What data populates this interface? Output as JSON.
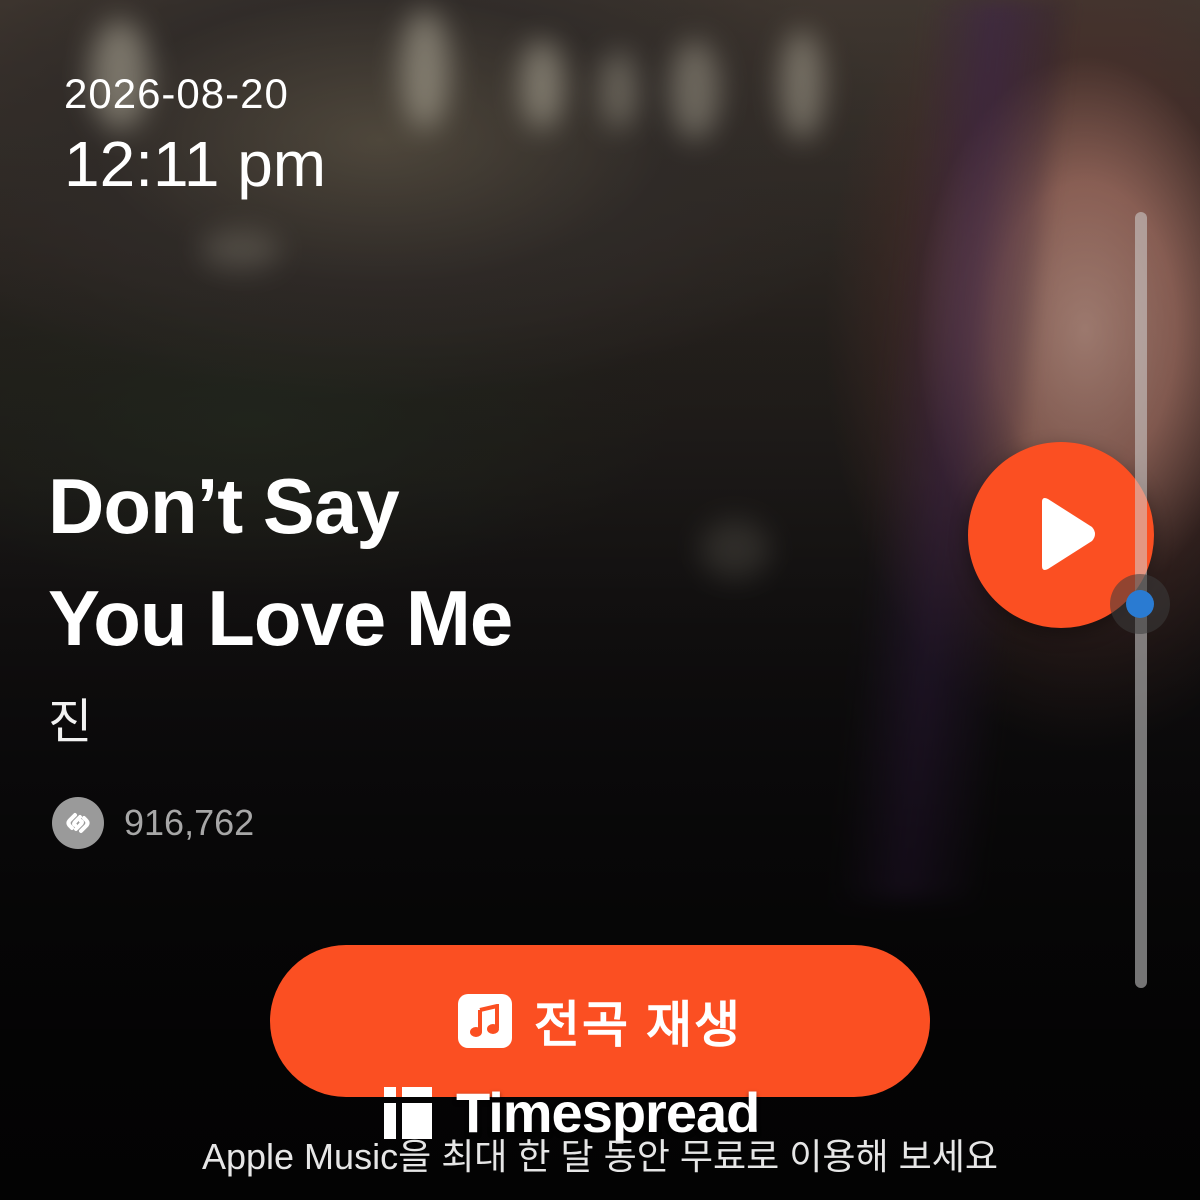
{
  "status": {
    "date": "2026-08-20",
    "time": "12:11 pm"
  },
  "song": {
    "title_line1": "Don’t Say",
    "title_line2": "You Love Me",
    "artist": "진",
    "shazam_count": "916,762"
  },
  "controls": {
    "play_icon": "play-icon",
    "scrubber_position": 0.5
  },
  "cta": {
    "label": "전곡 재생",
    "icon": "apple-music-note-icon"
  },
  "promo_text": "Apple Music을 최대 한 달 동안 무료로 이용해 보세요",
  "watermark": {
    "text": "Timespread"
  },
  "colors": {
    "accent": "#fb4f22",
    "scrubber_knob": "#2a7bd2",
    "count_text": "#a7a7a7"
  }
}
